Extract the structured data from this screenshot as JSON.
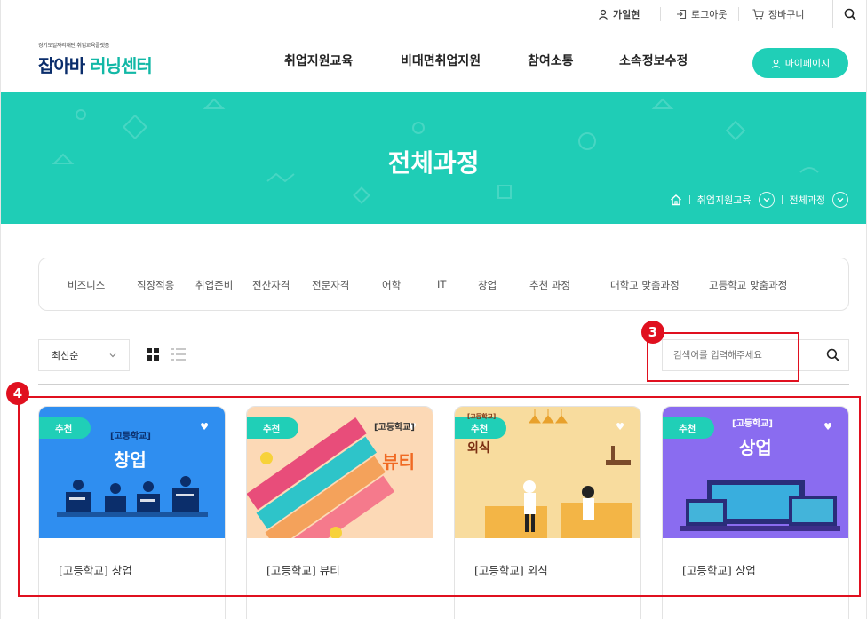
{
  "util": {
    "user_name": "가일현",
    "logout": "로그아웃",
    "cart": "장바구니"
  },
  "header": {
    "logo_sub": "경기도일자리재단 취업교육플랫폼",
    "logo_main_a": "잡아바",
    "logo_main_b": " 러닝센터",
    "nav": [
      "취업지원교육",
      "비대면취업지원",
      "참여소통",
      "소속정보수정"
    ],
    "mypage": "마이페이지",
    "brand_color": "#20cfb7"
  },
  "hero": {
    "title": "전체과정",
    "breadcrumb": [
      "취업지원교육",
      "전체과정"
    ]
  },
  "categories": [
    "비즈니스",
    "직장적응",
    "취업준비",
    "전산자격",
    "전문자격",
    "어학",
    "IT",
    "창업",
    "추천 과정",
    "대학교 맞춤과정",
    "고등학교 맞춤과정"
  ],
  "toolbar": {
    "sort": "최신순",
    "search_placeholder": "검색어를 입력해주세요"
  },
  "annotations": {
    "search_marker": "3",
    "cards_marker": "4"
  },
  "cards": [
    {
      "badge": "추천",
      "thumb_tag": "[고등학교]",
      "thumb_title": "창업",
      "title": "[고등학교] 창업",
      "bg": "#2f8ef0"
    },
    {
      "badge": "추천",
      "thumb_tag": "[고등학교]",
      "thumb_title": "뷰티",
      "title": "[고등학교] 뷰티",
      "bg": "#fcd9b6"
    },
    {
      "badge": "추천",
      "thumb_tag": "[고등학교]",
      "thumb_title": "외식",
      "title": "[고등학교] 외식",
      "bg": "#f8dc9e"
    },
    {
      "badge": "추천",
      "thumb_tag": "[고등학교]",
      "thumb_title": "상업",
      "title": "[고등학교] 상업",
      "bg": "#8a6cf0"
    }
  ]
}
